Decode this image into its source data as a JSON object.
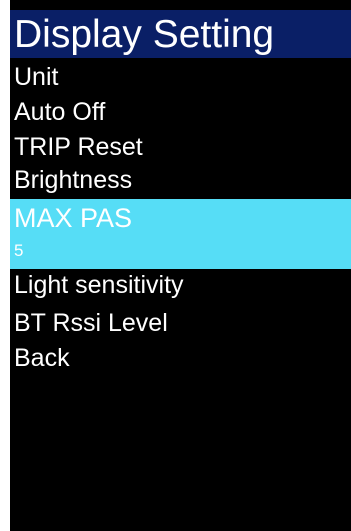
{
  "header": {
    "title": "Display Setting"
  },
  "menu": {
    "items": [
      {
        "label": "Unit"
      },
      {
        "label": "Auto Off"
      },
      {
        "label": "TRIP Reset"
      },
      {
        "label": "Brightness"
      },
      {
        "label": "MAX PAS",
        "value": "5",
        "selected": true
      },
      {
        "label": "Light sensitivity"
      },
      {
        "label": "BT Rssi Level"
      },
      {
        "label": "Back"
      }
    ]
  },
  "colors": {
    "title_bar": "#0a1f66",
    "highlight": "#56ddf6",
    "background": "#000000",
    "text": "#ffffff"
  }
}
